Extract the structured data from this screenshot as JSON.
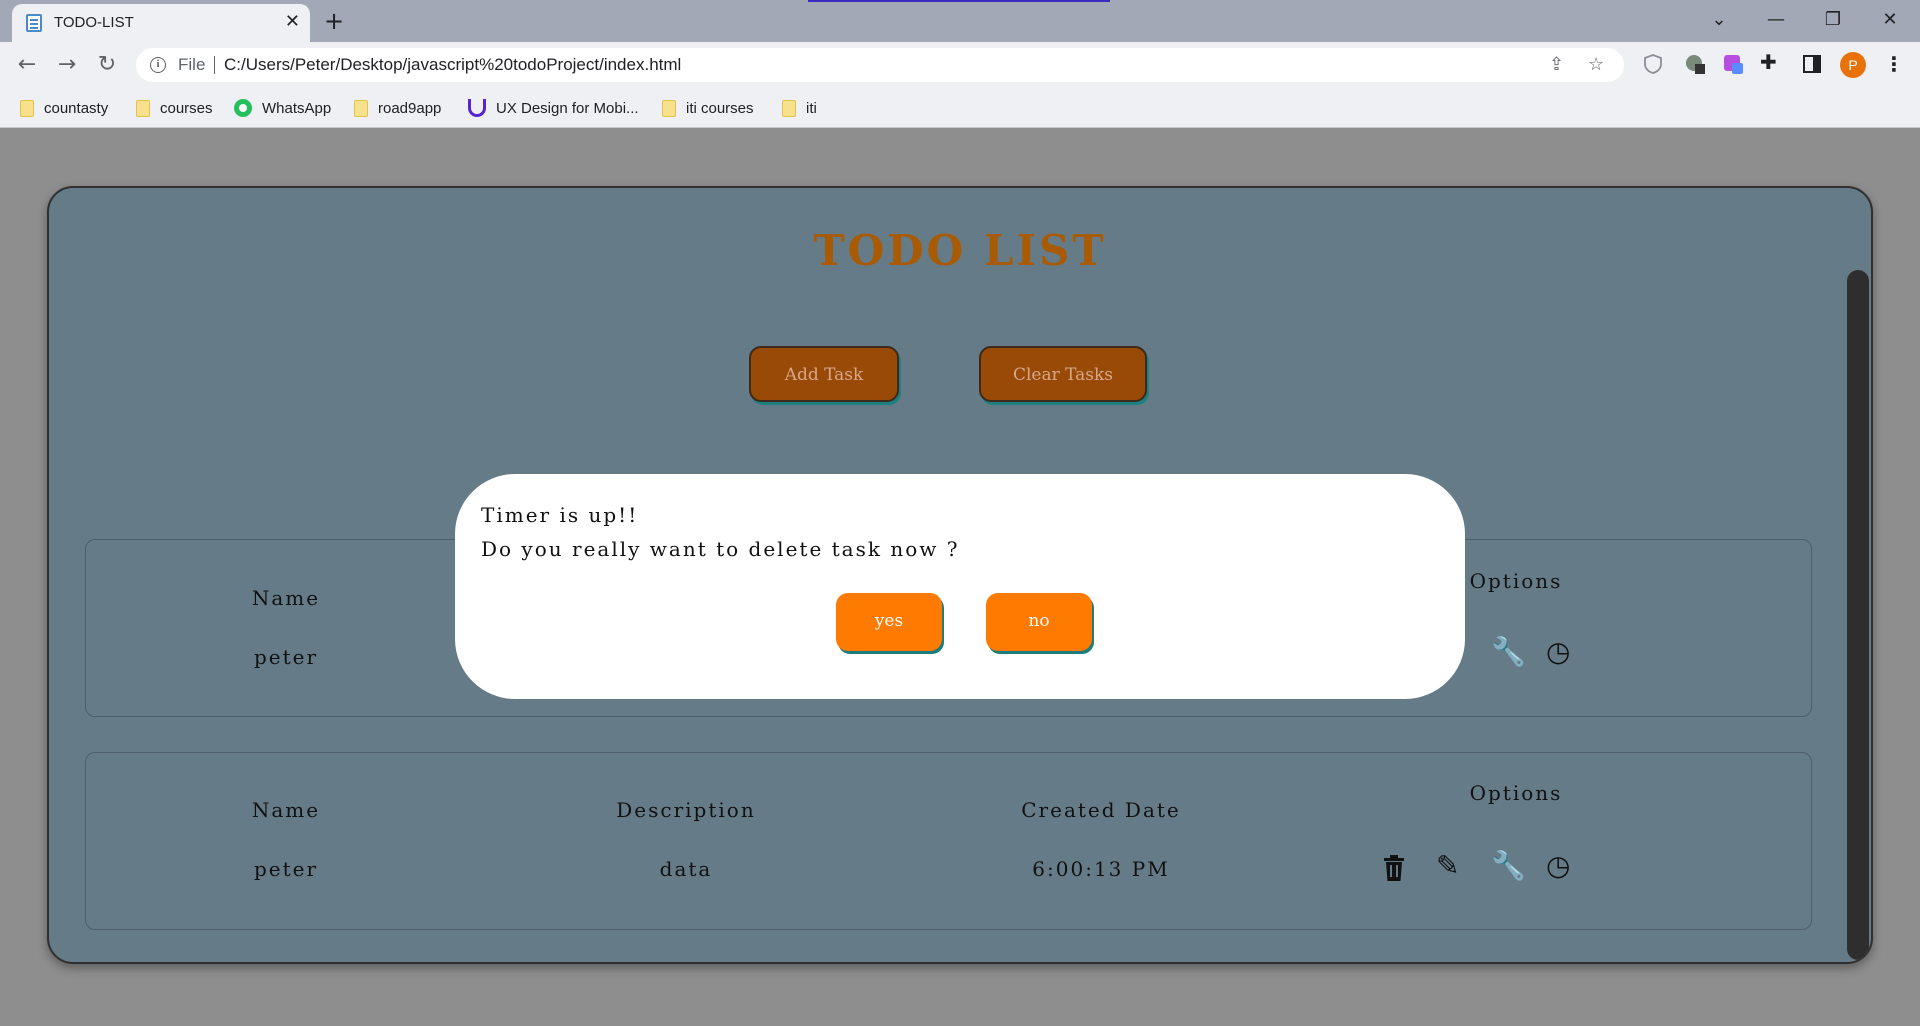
{
  "browser": {
    "tab_title": "TODO-LIST",
    "tab_close": "✕",
    "new_tab": "+",
    "scheme_label": "File",
    "url": "C:/Users/Peter/Desktop/javascript%20todoProject/index.html",
    "profile_initial": "P",
    "window_controls": {
      "minimize": "—",
      "restore": "❐",
      "close": "✕",
      "tab_search": "⌄"
    },
    "bookmarks": [
      {
        "label": "countasty",
        "icon": "folder-icon"
      },
      {
        "label": "courses",
        "icon": "folder-icon"
      },
      {
        "label": "WhatsApp",
        "icon": "whatsapp-icon"
      },
      {
        "label": "road9app",
        "icon": "folder-icon"
      },
      {
        "label": "UX Design for Mobi...",
        "icon": "udemy-icon"
      },
      {
        "label": "iti courses",
        "icon": "folder-icon"
      },
      {
        "label": "iti",
        "icon": "folder-icon"
      }
    ]
  },
  "app": {
    "title": "TODO LIST",
    "add_task_label": "Add Task",
    "clear_tasks_label": "Clear Tasks",
    "accent_color": "#a85a05",
    "tasks": [
      {
        "headers": {
          "name": "Name",
          "options": "Options"
        },
        "name": "peter"
      },
      {
        "headers": {
          "name": "Name",
          "description": "Description",
          "created": "Created Date",
          "options": "Options"
        },
        "name": "peter",
        "description": "data",
        "created": "6:00:13 PM"
      }
    ]
  },
  "modal": {
    "line1": "Timer is up!!",
    "line2": "Do you really want to delete task now ?",
    "yes_label": "yes",
    "no_label": "no",
    "button_color": "#ff7a00"
  }
}
